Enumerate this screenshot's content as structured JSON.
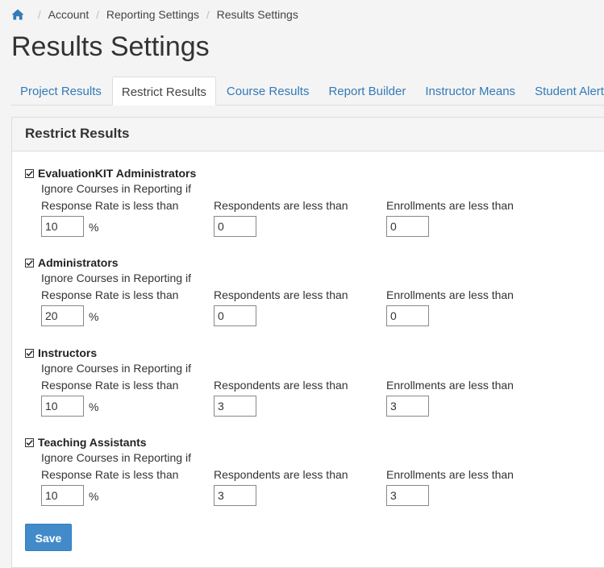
{
  "breadcrumb": {
    "items": [
      "Account",
      "Reporting Settings",
      "Results Settings"
    ]
  },
  "page_title": "Results Settings",
  "tabs": [
    {
      "label": "Project Results"
    },
    {
      "label": "Restrict Results",
      "active": true
    },
    {
      "label": "Course Results"
    },
    {
      "label": "Report Builder"
    },
    {
      "label": "Instructor Means"
    },
    {
      "label": "Student Alert"
    }
  ],
  "panel": {
    "heading": "Restrict Results",
    "ignore_label": "Ignore Courses in Reporting if",
    "labels": {
      "response_rate": "Response Rate is less than",
      "respondents": "Respondents are less than",
      "enrollments": "Enrollments are less than",
      "percent": "%"
    },
    "groups": [
      {
        "role": "EvaluationKIT Administrators",
        "checked": true,
        "response_rate": "10",
        "respondents": "0",
        "enrollments": "0"
      },
      {
        "role": "Administrators",
        "checked": true,
        "response_rate": "20",
        "respondents": "0",
        "enrollments": "0"
      },
      {
        "role": "Instructors",
        "checked": true,
        "response_rate": "10",
        "respondents": "3",
        "enrollments": "3"
      },
      {
        "role": "Teaching Assistants",
        "checked": true,
        "response_rate": "10",
        "respondents": "3",
        "enrollments": "3"
      }
    ],
    "save_label": "Save"
  },
  "colors": {
    "link": "#337ab7",
    "button": "#428bca"
  },
  "icons": {
    "home": "home-icon",
    "check": "checkmark-icon"
  }
}
